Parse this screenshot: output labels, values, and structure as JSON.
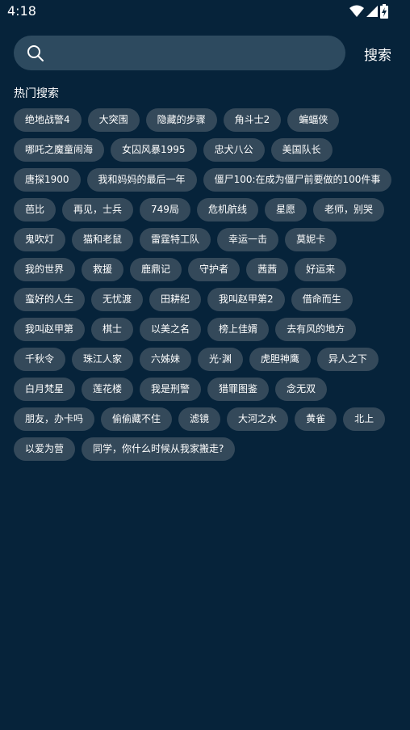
{
  "status_bar": {
    "time": "4:18"
  },
  "search": {
    "placeholder": "",
    "button_label": "搜索"
  },
  "hot_search": {
    "title": "热门搜索",
    "tags": [
      "绝地战警4",
      "大突围",
      "隐藏的步骤",
      "角斗士2",
      "蝙蝠侠",
      "哪吒之魔童闹海",
      "女囚风暴1995",
      "忠犬八公",
      "美国队长",
      "唐探1900",
      "我和妈妈的最后一年",
      "僵尸100:在成为僵尸前要做的100件事",
      "芭比",
      "再见，士兵",
      "749局",
      "危机航线",
      "星愿",
      "老师，别哭",
      "鬼吹灯",
      "猫和老鼠",
      "雷霆特工队",
      "幸运一击",
      "莫妮卡",
      "我的世界",
      "救援",
      "鹿鼎记",
      "守护者",
      "茜茜",
      "好运来",
      "蛮好的人生",
      "无忧渡",
      "田耕纪",
      "我叫赵甲第2",
      "借命而生",
      "我叫赵甲第",
      "棋士",
      "以美之名",
      "榜上佳婿",
      "去有风的地方",
      "千秋令",
      "珠江人家",
      "六姊妹",
      "光·渊",
      "虎胆神鹰",
      "异人之下",
      "白月梵星",
      "莲花楼",
      "我是刑警",
      "猎罪图鉴",
      "念无双",
      "朋友，办卡吗",
      "偷偷藏不住",
      "滤镜",
      "大河之水",
      "黄雀",
      "北上",
      "以爱为营",
      "同学，你什么时候从我家搬走?"
    ]
  }
}
